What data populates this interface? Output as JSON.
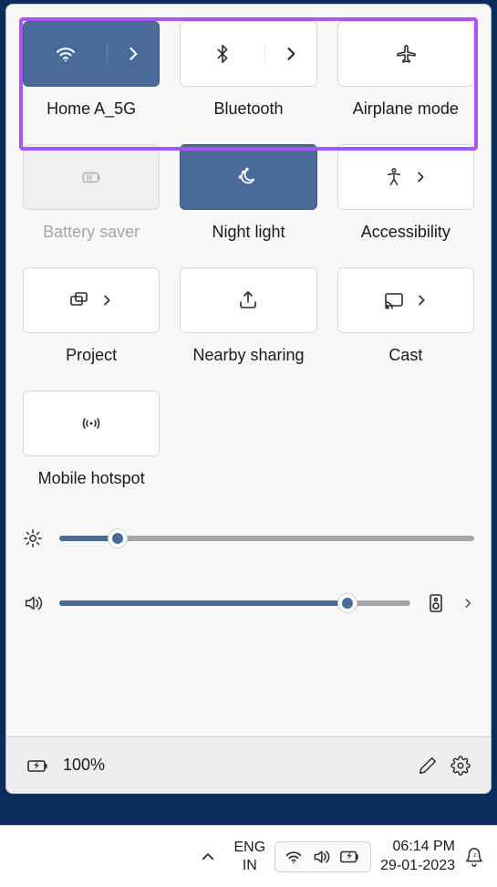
{
  "network_row": {
    "wifi": {
      "label": "Home A_5G",
      "active": true
    },
    "bluetooth": {
      "label": "Bluetooth",
      "active": false
    },
    "airplane": {
      "label": "Airplane mode",
      "active": false
    }
  },
  "toggles": {
    "battery_saver": {
      "label": "Battery saver",
      "disabled": true
    },
    "night_light": {
      "label": "Night light",
      "active": true
    },
    "accessibility": {
      "label": "Accessibility"
    },
    "project": {
      "label": "Project"
    },
    "nearby": {
      "label": "Nearby sharing"
    },
    "cast": {
      "label": "Cast"
    },
    "hotspot": {
      "label": "Mobile hotspot"
    }
  },
  "sliders": {
    "brightness": {
      "value": 14
    },
    "volume": {
      "value": 82
    }
  },
  "footer": {
    "battery_text": "100%"
  },
  "taskbar": {
    "lang_top": "ENG",
    "lang_bottom": "IN",
    "time": "06:14 PM",
    "date": "29-01-2023"
  }
}
